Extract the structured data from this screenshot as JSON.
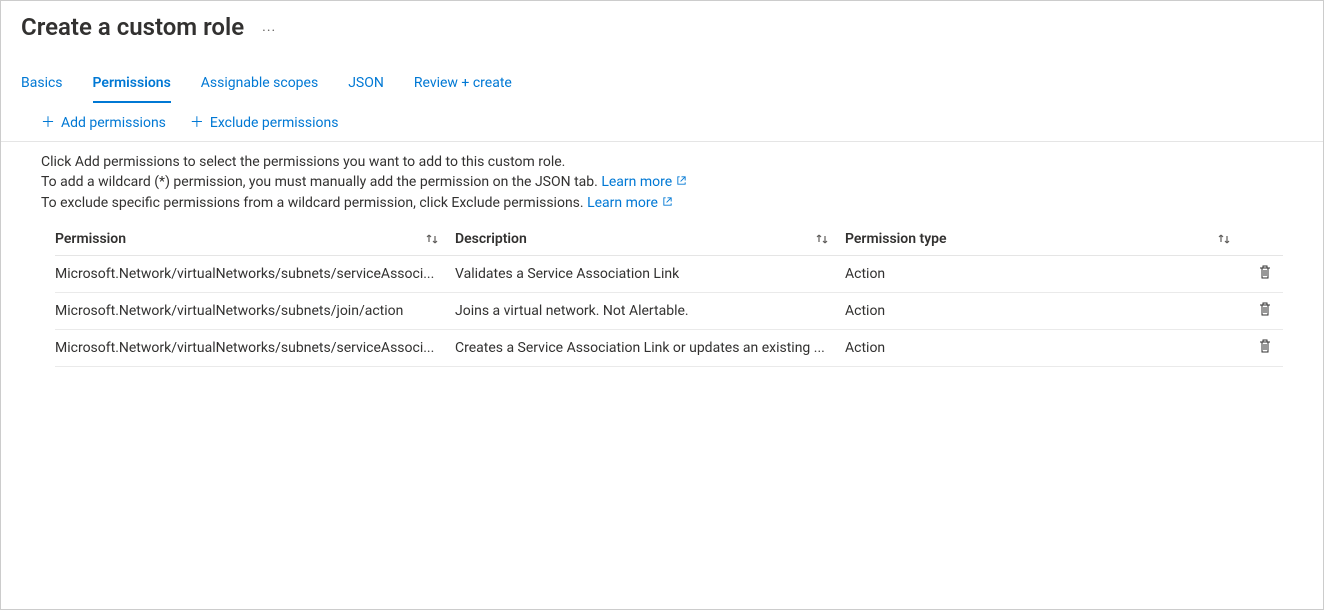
{
  "header": {
    "title": "Create a custom role",
    "more": "..."
  },
  "tabs": {
    "items": [
      {
        "label": "Basics"
      },
      {
        "label": "Permissions"
      },
      {
        "label": "Assignable scopes"
      },
      {
        "label": "JSON"
      },
      {
        "label": "Review + create"
      }
    ],
    "active_index": 1
  },
  "toolbar": {
    "add_label": "Add permissions",
    "exclude_label": "Exclude permissions"
  },
  "help": {
    "line1": "Click Add permissions to select the permissions you want to add to this custom role.",
    "line2_a": "To add a wildcard (*) permission, you must manually add the permission on the JSON tab. ",
    "line2_link": "Learn more",
    "line3_a": "To exclude specific permissions from a wildcard permission, click Exclude permissions. ",
    "line3_link": "Learn more"
  },
  "table": {
    "headers": {
      "permission": "Permission",
      "description": "Description",
      "type": "Permission type"
    },
    "rows": [
      {
        "permission": "Microsoft.Network/virtualNetworks/subnets/serviceAssoci...",
        "description": "Validates a Service Association Link",
        "type": "Action"
      },
      {
        "permission": "Microsoft.Network/virtualNetworks/subnets/join/action",
        "description": "Joins a virtual network. Not Alertable.",
        "type": "Action"
      },
      {
        "permission": "Microsoft.Network/virtualNetworks/subnets/serviceAssoci...",
        "description": "Creates a Service Association Link or updates an existing ...",
        "type": "Action"
      }
    ]
  }
}
